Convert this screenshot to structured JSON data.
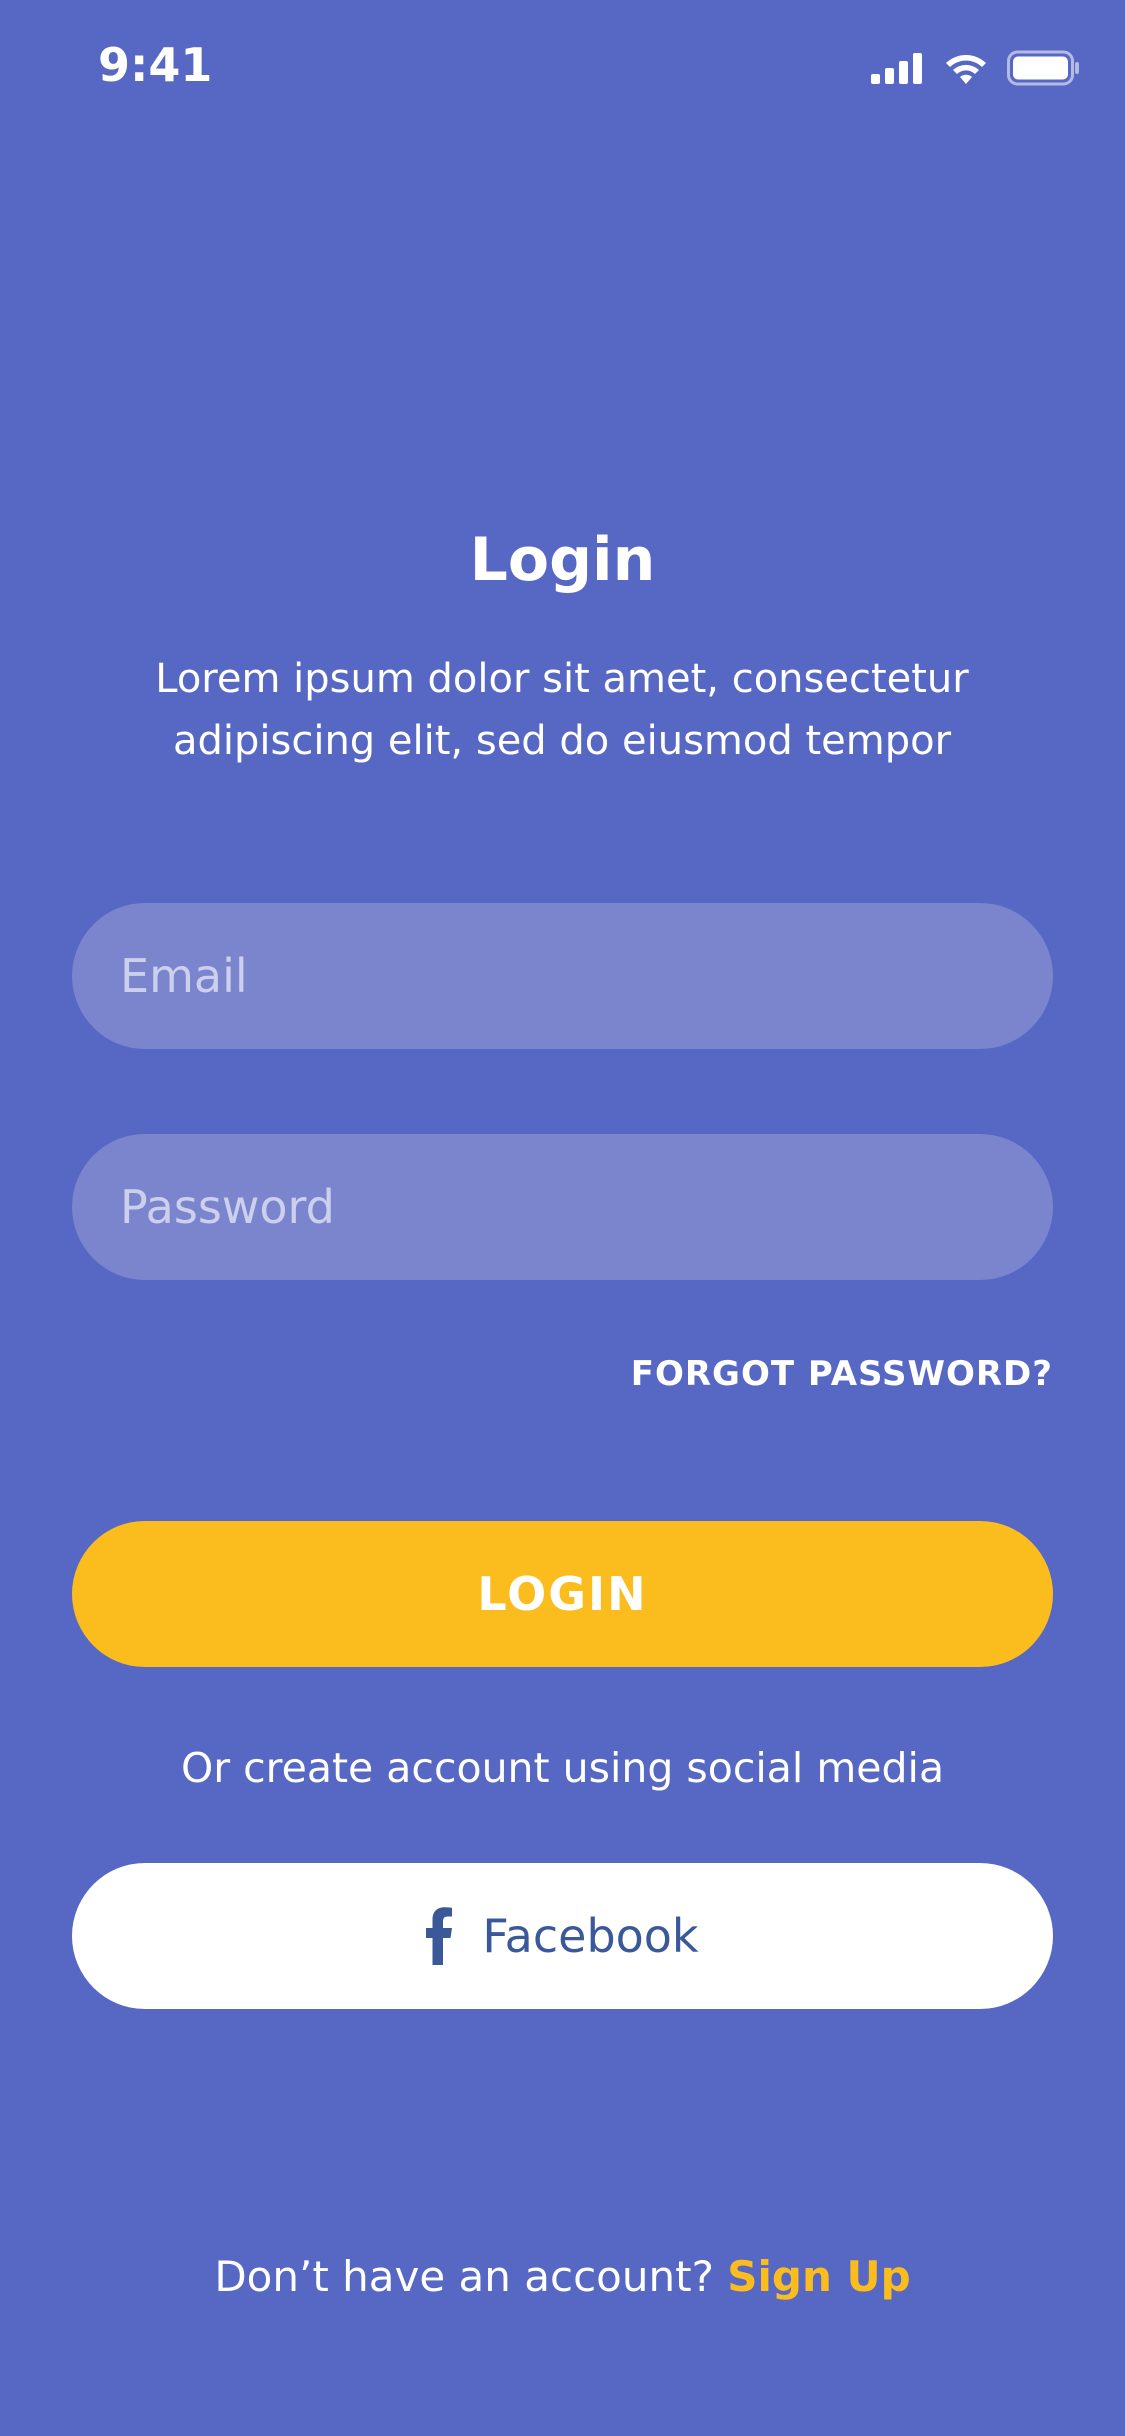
{
  "status_bar": {
    "time": "9:41",
    "icons": [
      "cellular-signal-icon",
      "wifi-icon",
      "battery-icon"
    ]
  },
  "header": {
    "title": "Login",
    "subtitle": "Lorem ipsum dolor sit amet, consectetur adipiscing elit, sed do eiusmod tempor"
  },
  "form": {
    "email_placeholder": "Email",
    "email_value": "",
    "password_placeholder": "Password",
    "password_value": "",
    "forgot_label": "FORGOT PASSWORD?",
    "login_label": "LOGIN"
  },
  "social": {
    "prompt": "Or create account using social media",
    "facebook_label": "Facebook",
    "facebook_icon": "facebook-icon"
  },
  "footer": {
    "prompt": "Don’t have an account?",
    "signup_label": "Sign Up"
  },
  "colors": {
    "background": "#5767c4",
    "input_fill": "#7a85ce",
    "accent": "#fbbd1e",
    "facebook_blue": "#3b5998",
    "text": "#ffffff"
  }
}
